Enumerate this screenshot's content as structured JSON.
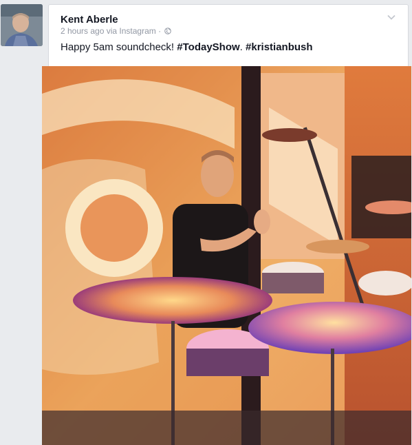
{
  "post": {
    "author": "Kent Aberle",
    "time": "2 hours ago",
    "via": "via Instagram",
    "separator": "·",
    "text_prefix": "Happy 5am soundcheck! ",
    "hashtag_1": "#TodayShow",
    "text_middle": ". ",
    "hashtag_2": "#kristianbush",
    "privacy_icon": "globe-icon",
    "menu_icon": "chevron-down-icon"
  },
  "photo": {
    "description_icon": "drummer-photo"
  }
}
